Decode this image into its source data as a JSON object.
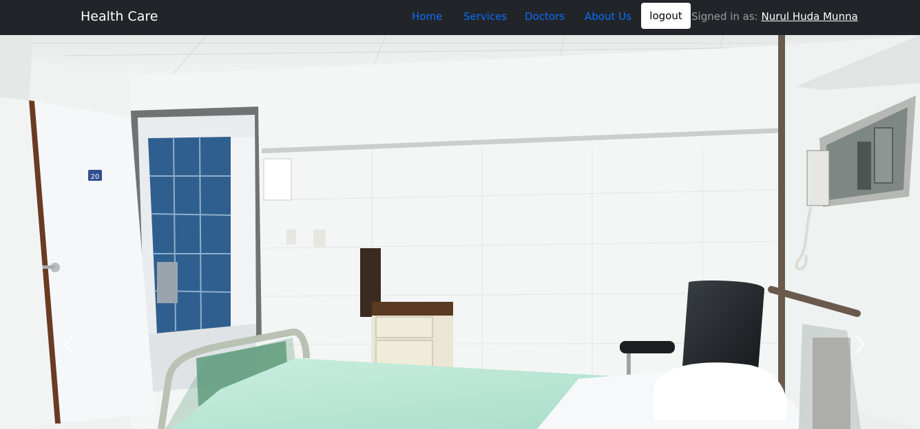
{
  "navbar": {
    "brand": "Health Care",
    "links": [
      {
        "label": "Home"
      },
      {
        "label": "Services"
      },
      {
        "label": "Doctors"
      },
      {
        "label": "About Us"
      }
    ],
    "logout_label": "logout",
    "signed_in_prefix": "Signed in as: ",
    "user_name": "Nurul Huda Munna"
  },
  "colors": {
    "navbar_bg": "#212529",
    "link": "#0d6efd",
    "brand": "#ffffff"
  },
  "hero": {
    "room_number": "20",
    "icons": [
      "chevron-left-icon",
      "chevron-right-icon"
    ]
  }
}
